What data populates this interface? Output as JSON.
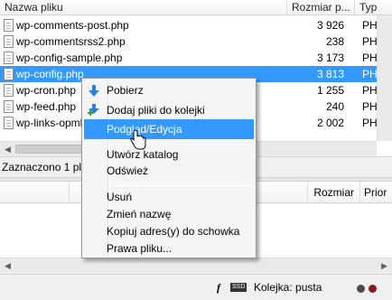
{
  "remote_files": {
    "columns": [
      "Nazwa pliku",
      "Rozmiar p...",
      "Typ"
    ],
    "rows": [
      {
        "name": "wp-comments-post.php",
        "size": "3 926",
        "type": "PH"
      },
      {
        "name": "wp-commentsrss2.php",
        "size": "238",
        "type": "PH"
      },
      {
        "name": "wp-config-sample.php",
        "size": "3 173",
        "type": "PH"
      },
      {
        "name": "wp-config.php",
        "size": "3 813",
        "type": "PH"
      },
      {
        "name": "wp-cron.php",
        "size": "1 255",
        "type": "PH"
      },
      {
        "name": "wp-feed.php",
        "size": "240",
        "type": "PH"
      },
      {
        "name": "wp-links-opml.php",
        "size": "2 002",
        "type": "PH"
      }
    ],
    "selected_index": 3,
    "status": "Zaznaczono 1 plik"
  },
  "queue": {
    "columns": {
      "size": "Rozmiar",
      "priority": "Prior"
    }
  },
  "context_menu": {
    "items": [
      {
        "label": "Pobierz",
        "icon": "download-arrow-icon"
      },
      {
        "label": "Dodaj pliki do kolejki",
        "icon": "add-to-queue-icon"
      },
      {
        "label": "Podgląd/Edycja",
        "highlighted": true
      },
      {
        "label": "Utwórz katalog"
      },
      {
        "label": "Odśwież"
      },
      {
        "label": "Usuń"
      },
      {
        "label": "Zmień nazwę"
      },
      {
        "label": "Kopiuj adres(y) do schowka"
      },
      {
        "label": "Prawa pliku..."
      }
    ]
  },
  "statusbar": {
    "queue_label": "Kolejka: pusta",
    "encryption_badge": "SSD"
  },
  "colors": {
    "selection": "#3399ff",
    "menu_highlight": "#3399ff",
    "arrow_blue": "#2f7fd8",
    "plus_green": "#2fa82f"
  }
}
